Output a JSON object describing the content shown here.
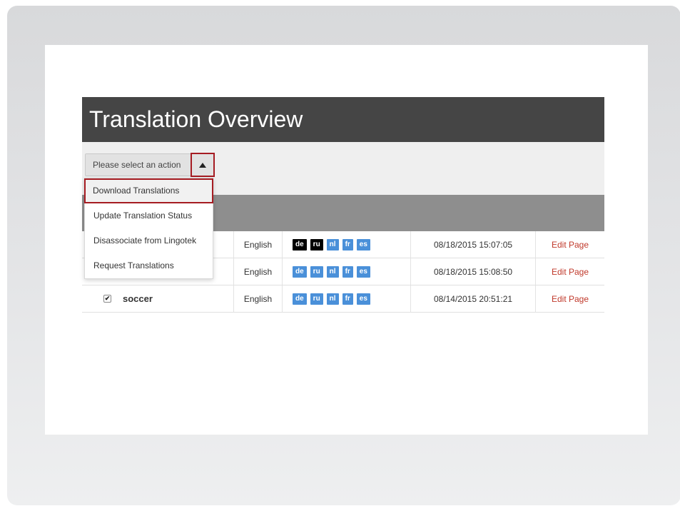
{
  "page": {
    "title": "Translation Overview"
  },
  "action_select": {
    "label": "Please select an action",
    "options": [
      "Download Translations",
      "Update Translation Status",
      "Disassociate from Lingotek",
      "Request Translations"
    ],
    "highlighted_index": 0
  },
  "table": {
    "rows": [
      {
        "title": "",
        "language": "English",
        "badges": [
          {
            "code": "de",
            "color": "black"
          },
          {
            "code": "ru",
            "color": "black"
          },
          {
            "code": "nl",
            "color": "blue"
          },
          {
            "code": "fr",
            "color": "blue"
          },
          {
            "code": "es",
            "color": "blue"
          }
        ],
        "date": "08/18/2015 15:07:05",
        "action": "Edit Page"
      },
      {
        "title": "",
        "language": "English",
        "badges": [
          {
            "code": "de",
            "color": "blue"
          },
          {
            "code": "ru",
            "color": "blue"
          },
          {
            "code": "nl",
            "color": "blue"
          },
          {
            "code": "fr",
            "color": "blue"
          },
          {
            "code": "es",
            "color": "blue"
          }
        ],
        "date": "08/18/2015 15:08:50",
        "action": "Edit Page"
      },
      {
        "title": "soccer",
        "checked": true,
        "language": "English",
        "badges": [
          {
            "code": "de",
            "color": "blue"
          },
          {
            "code": "ru",
            "color": "blue"
          },
          {
            "code": "nl",
            "color": "blue"
          },
          {
            "code": "fr",
            "color": "blue"
          },
          {
            "code": "es",
            "color": "blue"
          }
        ],
        "date": "08/14/2015 20:51:21",
        "action": "Edit Page"
      }
    ]
  },
  "colors": {
    "title_bar": "#454545",
    "highlight_border": "#a61c22",
    "badge_blue": "#4a90d9",
    "badge_black": "#000000",
    "edit_link": "#c0392b"
  },
  "icons": {
    "toggle": "caret-up-icon",
    "checkbox": "checkmark-icon"
  }
}
